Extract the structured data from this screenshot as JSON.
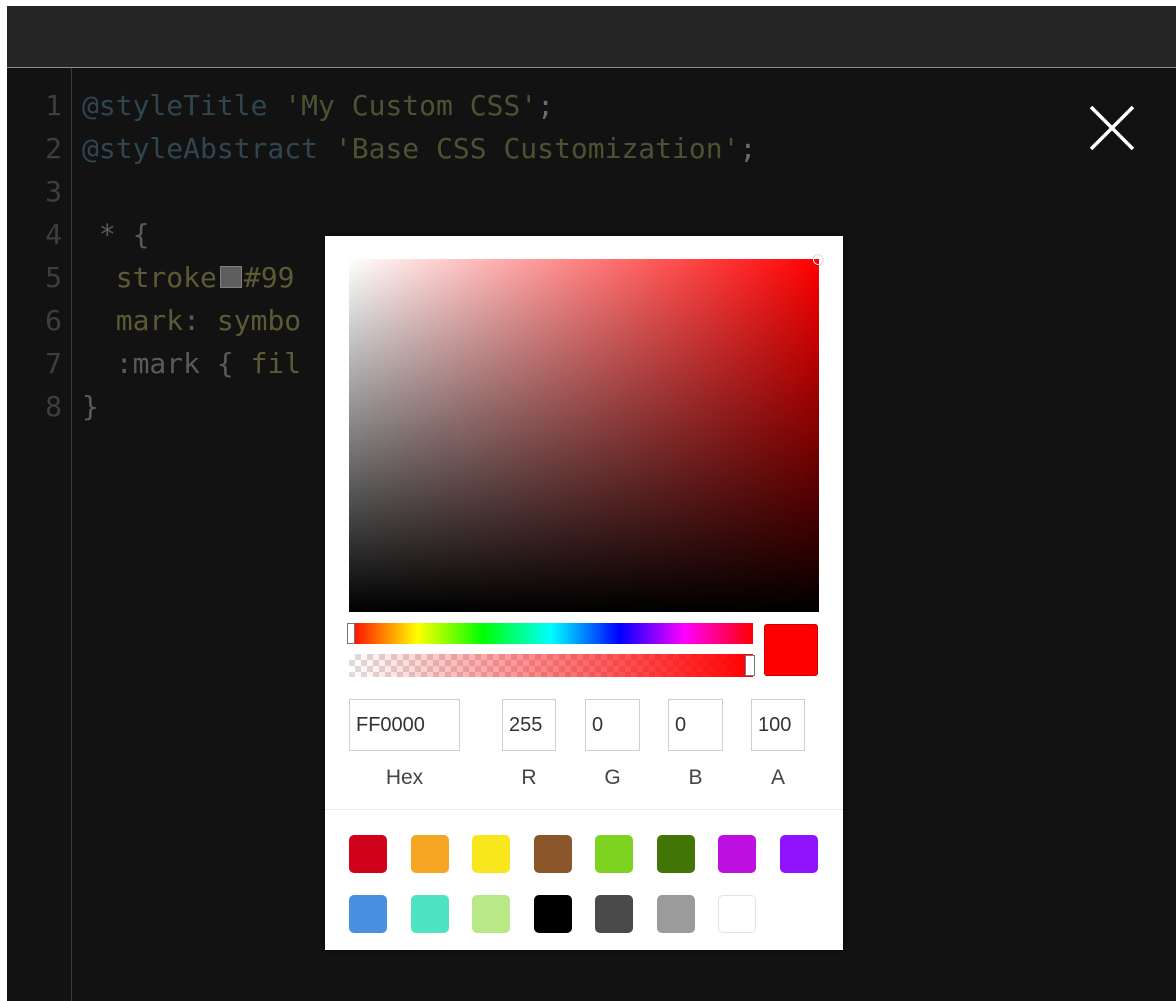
{
  "editor": {
    "close_label": "Close",
    "lines": [
      {
        "num": "1",
        "tokens": [
          {
            "t": "@styleTitle ",
            "c": "t-at"
          },
          {
            "t": "'My Custom CSS'",
            "c": "t-str"
          },
          {
            "t": ";",
            "c": "t-pun"
          }
        ]
      },
      {
        "num": "2",
        "tokens": [
          {
            "t": "@styleAbstract ",
            "c": "t-at"
          },
          {
            "t": "'Base CSS Customization'",
            "c": "t-str"
          },
          {
            "t": ";",
            "c": "t-pun"
          }
        ]
      },
      {
        "num": "3",
        "tokens": []
      },
      {
        "num": "4",
        "tokens": [
          {
            "t": " * {",
            "c": "t-sel"
          }
        ]
      },
      {
        "num": "5",
        "tokens": [
          {
            "t": "  stroke",
            "c": "t-prop"
          },
          {
            "swatch": true
          },
          {
            "t": "#99",
            "c": "t-prop"
          }
        ]
      },
      {
        "num": "6",
        "tokens": [
          {
            "t": "  mark",
            "c": "t-prop"
          },
          {
            "t": ": ",
            "c": "t-sel"
          },
          {
            "t": "symbo",
            "c": "t-prop"
          }
        ]
      },
      {
        "num": "7",
        "tokens": [
          {
            "t": "  :mark { ",
            "c": "t-sel"
          },
          {
            "t": "fil",
            "c": "t-prop"
          }
        ]
      },
      {
        "num": "8",
        "tokens": [
          {
            "t": "}",
            "c": "t-sel"
          }
        ]
      }
    ]
  },
  "picker": {
    "current_color": "#ff0000",
    "hex_value": "FF0000",
    "r_value": "255",
    "g_value": "0",
    "b_value": "0",
    "a_value": "100",
    "labels": {
      "hex": "Hex",
      "r": "R",
      "g": "G",
      "b": "B",
      "a": "A"
    },
    "presets": [
      "#d0021b",
      "#f5a623",
      "#f8e71c",
      "#8b572a",
      "#7ed321",
      "#417505",
      "#bd10e0",
      "#9013fe",
      "#4a90e2",
      "#50e3c2",
      "#b8e986",
      "#000000",
      "#4a4a4a",
      "#9b9b9b",
      "#ffffff"
    ]
  }
}
